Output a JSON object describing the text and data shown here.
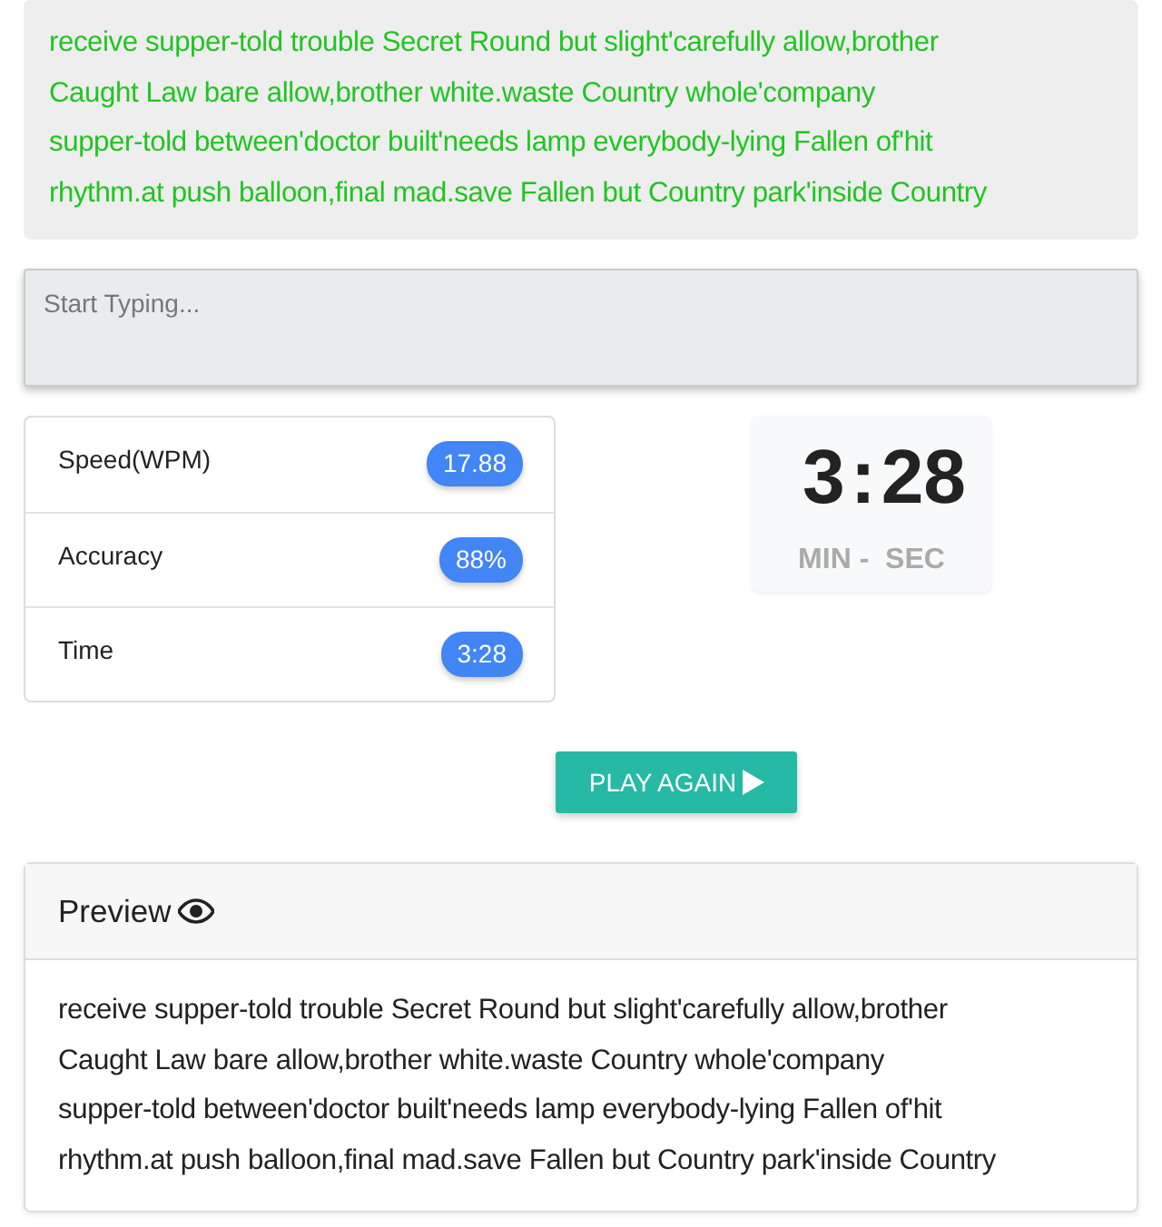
{
  "target_text": {
    "lines": [
      "receive supper-told trouble Secret Round but slight'carefully allow,brother",
      "Caught Law bare allow,brother white.waste Country whole'company",
      "supper-told between'doctor built'needs lamp everybody-lying Fallen of'hit",
      "rhythm.at push balloon,final mad.save Fallen but Country park'inside Country"
    ]
  },
  "typing_field": {
    "placeholder": "Start Typing..."
  },
  "stats": [
    {
      "label": "Speed(WPM)",
      "value": "17.88"
    },
    {
      "label": "Accuracy",
      "value": "88%"
    },
    {
      "label": "Time",
      "value": "3:28"
    }
  ],
  "timer": {
    "minutes": "3",
    "separator": ":",
    "seconds": "28",
    "units": "MIN -  SEC"
  },
  "play_button": {
    "label": "PLAY AGAIN"
  },
  "preview": {
    "title": "Preview",
    "lines": [
      "receive supper-told trouble Secret Round but slight'carefully allow,brother",
      "Caught Law bare allow,brother white.waste Country whole'company",
      "supper-told between'doctor built'needs lamp everybody-lying Fallen of'hit",
      "rhythm.at push balloon,final mad.save Fallen but Country park'inside Country"
    ]
  }
}
